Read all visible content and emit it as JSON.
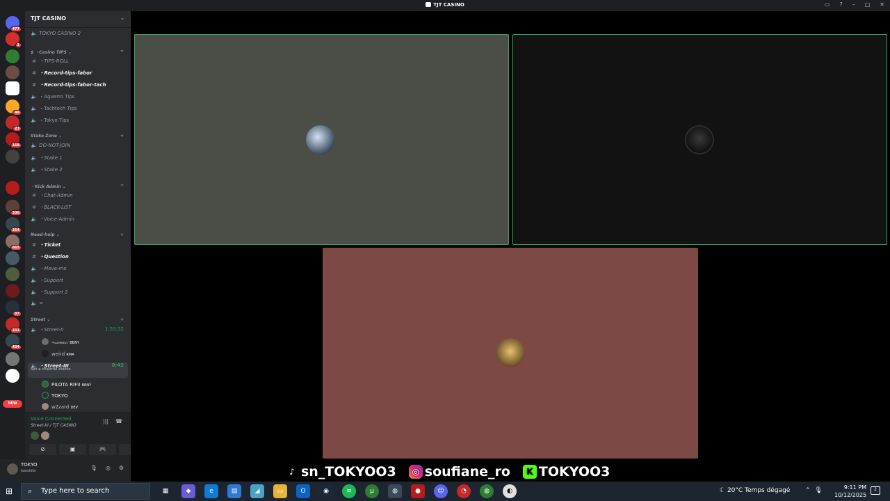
{
  "window": {
    "title": "TJT CASINO"
  },
  "servers": [
    {
      "badge": "477",
      "color": "#5865f2"
    },
    {
      "badge": "1",
      "color": "#d32f2f"
    },
    {
      "badge": "",
      "color": "#2e7d32"
    },
    {
      "badge": "",
      "color": "#6d4c41"
    },
    {
      "badge": "",
      "color": "#ffffff"
    },
    {
      "badge": "48",
      "color": "#f9a825"
    },
    {
      "badge": "23",
      "color": "#c62828"
    },
    {
      "badge": "168",
      "color": "#b71c1c"
    },
    {
      "badge": "",
      "color": "#424242"
    },
    {
      "badge": "",
      "color": "#b71c1c"
    },
    {
      "badge": "336",
      "color": "#5d4037"
    },
    {
      "badge": "254",
      "color": "#37474f"
    },
    {
      "badge": "665",
      "color": "#8d6e63"
    },
    {
      "badge": "",
      "color": "#455a64"
    },
    {
      "badge": "",
      "color": "#4e5d3a"
    },
    {
      "badge": "",
      "color": "#6d1b1b"
    },
    {
      "badge": "97",
      "color": "#263238"
    },
    {
      "badge": "331",
      "color": "#c62828"
    },
    {
      "badge": "434",
      "color": "#37474f"
    },
    {
      "badge": "",
      "color": "#757575"
    },
    {
      "badge": "",
      "color": "#ffffff"
    },
    {
      "badge": "",
      "color": "#1e1f22"
    }
  ],
  "server_new_pill": "NEW",
  "server_t": "t",
  "channels": {
    "server_name": "TJT CASINO",
    "top": "TOKYO CASINO 2",
    "cat_casino": "$ ・Casino TIPS ⌄",
    "tips_roll": "TIPS-ROLL",
    "record1": "Record-tips-fabor",
    "record2": "Record-tips-fabor-tach",
    "aguerro": "Aguerro Tips",
    "tachtoch": "Tachtoch Tips",
    "tokyotips": "Tokyo Tips",
    "cat_stake": "Stake Zone ⌄",
    "donot": "DO-NOT-JOIN",
    "stake1": "Stake 1",
    "stake2": "Stake 2",
    "cat_kick": "・Kick Admin ⌄",
    "chatadmin": "Chat-Admin",
    "blacklist": "BLACK-LIST",
    "voiceadmin": "Voice-Admin",
    "cat_need": "Need-help ⌄",
    "ticket": "Ticket",
    "question": "Question",
    "moveme": "Move-me",
    "support": "Support",
    "support2": "Support 2",
    "empty": "=",
    "cat_street": "Street ⌄",
    "street2": "Street-II",
    "street2_time": "1:20:32",
    "u_smasi": "ᯓ𝓈𝓂𝒶𝓈𝒾",
    "u_smasi_tag": "BBNY",
    "u_weird": "weird",
    "u_weird_tag": "RMA",
    "street3": "Street-III",
    "street3_time": "0:42",
    "street3_status": "Set a channel status",
    "u_pilota": "PILOTA RIFII",
    "u_pilota_tag": "BBNY",
    "u_tokyo": "TOKYO",
    "u_w2zard": "w2zard",
    "u_w2zard_tag": "DEV"
  },
  "voice": {
    "connected": "Voice Connected",
    "location": "Street-III / TJT CASINO"
  },
  "user": {
    "name": "TOKYO",
    "status": "kanshifa"
  },
  "socials": {
    "tiktok": "sn_TOKYOO3",
    "instagram": "soufiane_ro",
    "kick": "TOKYOO3"
  },
  "taskbar": {
    "search_placeholder": "Type here to search",
    "weather": "20°C  Temps dégagé",
    "time": "9:11 PM",
    "date": "10/12/2025",
    "notif": "2"
  },
  "colors": {
    "speaking": "#3ba55d",
    "tile_gray": "#4b4e46",
    "tile_black": "#121213",
    "tile_red": "#7d4944"
  }
}
